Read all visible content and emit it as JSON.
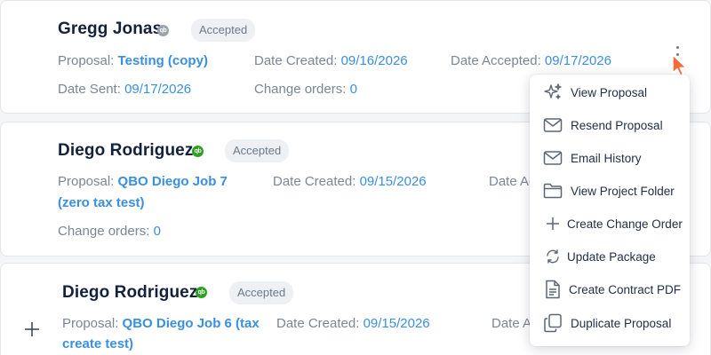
{
  "cards": [
    {
      "name": "Gregg Jonas",
      "qb_icon": "qb-icon-gray",
      "status": "Accepted",
      "proposal_label": "Proposal:",
      "proposal_value": "Testing (copy)",
      "date_created_label": "Date Created:",
      "date_created_value": "09/16/2026",
      "date_accepted_label": "Date Accepted:",
      "date_accepted_value": "09/17/2026",
      "date_sent_label": "Date Sent:",
      "date_sent_value": "09/17/2026",
      "change_orders_label": "Change orders:",
      "change_orders_value": "0"
    },
    {
      "name": "Diego Rodriguez",
      "qb_icon": "qb-icon-green",
      "status": "Accepted",
      "proposal_label": "Proposal:",
      "proposal_value_line1": "QBO Diego Job 7",
      "proposal_value_line2": "(zero tax test)",
      "date_created_label": "Date Created:",
      "date_created_value": "09/15/2026",
      "date_accepted_label_partial": "Date Ac",
      "change_orders_label": "Change orders:",
      "change_orders_value": "0"
    },
    {
      "name": "Diego Rodriguez",
      "qb_icon": "qb-icon-green",
      "status": "Accepted",
      "proposal_label": "Proposal:",
      "proposal_value_line1": "QBO Diego Job 6 (tax",
      "proposal_value_line2": "create test)",
      "date_created_label": "Date Created:",
      "date_created_value": "09/15/2026",
      "date_accepted_label_partial": "Date A"
    }
  ],
  "qb_icon_text": "qb",
  "menu": {
    "items": [
      {
        "label": "View Proposal",
        "icon": "sparkle-icon"
      },
      {
        "label": "Resend Proposal",
        "icon": "envelope-icon"
      },
      {
        "label": "Email History",
        "icon": "envelope-icon"
      },
      {
        "label": "View Project Folder",
        "icon": "folder-icon"
      },
      {
        "label": "Create Change Order",
        "icon": "plus-icon"
      },
      {
        "label": "Update Package",
        "icon": "refresh-icon"
      },
      {
        "label": "Create Contract PDF",
        "icon": "document-icon"
      },
      {
        "label": "Duplicate Proposal",
        "icon": "copy-icon"
      }
    ]
  },
  "colors": {
    "link": "#3a8fe0",
    "name": "#13223c",
    "label": "#7b8694",
    "qb_green": "#2ca01c",
    "cursor_orange": "#f26a3d"
  }
}
